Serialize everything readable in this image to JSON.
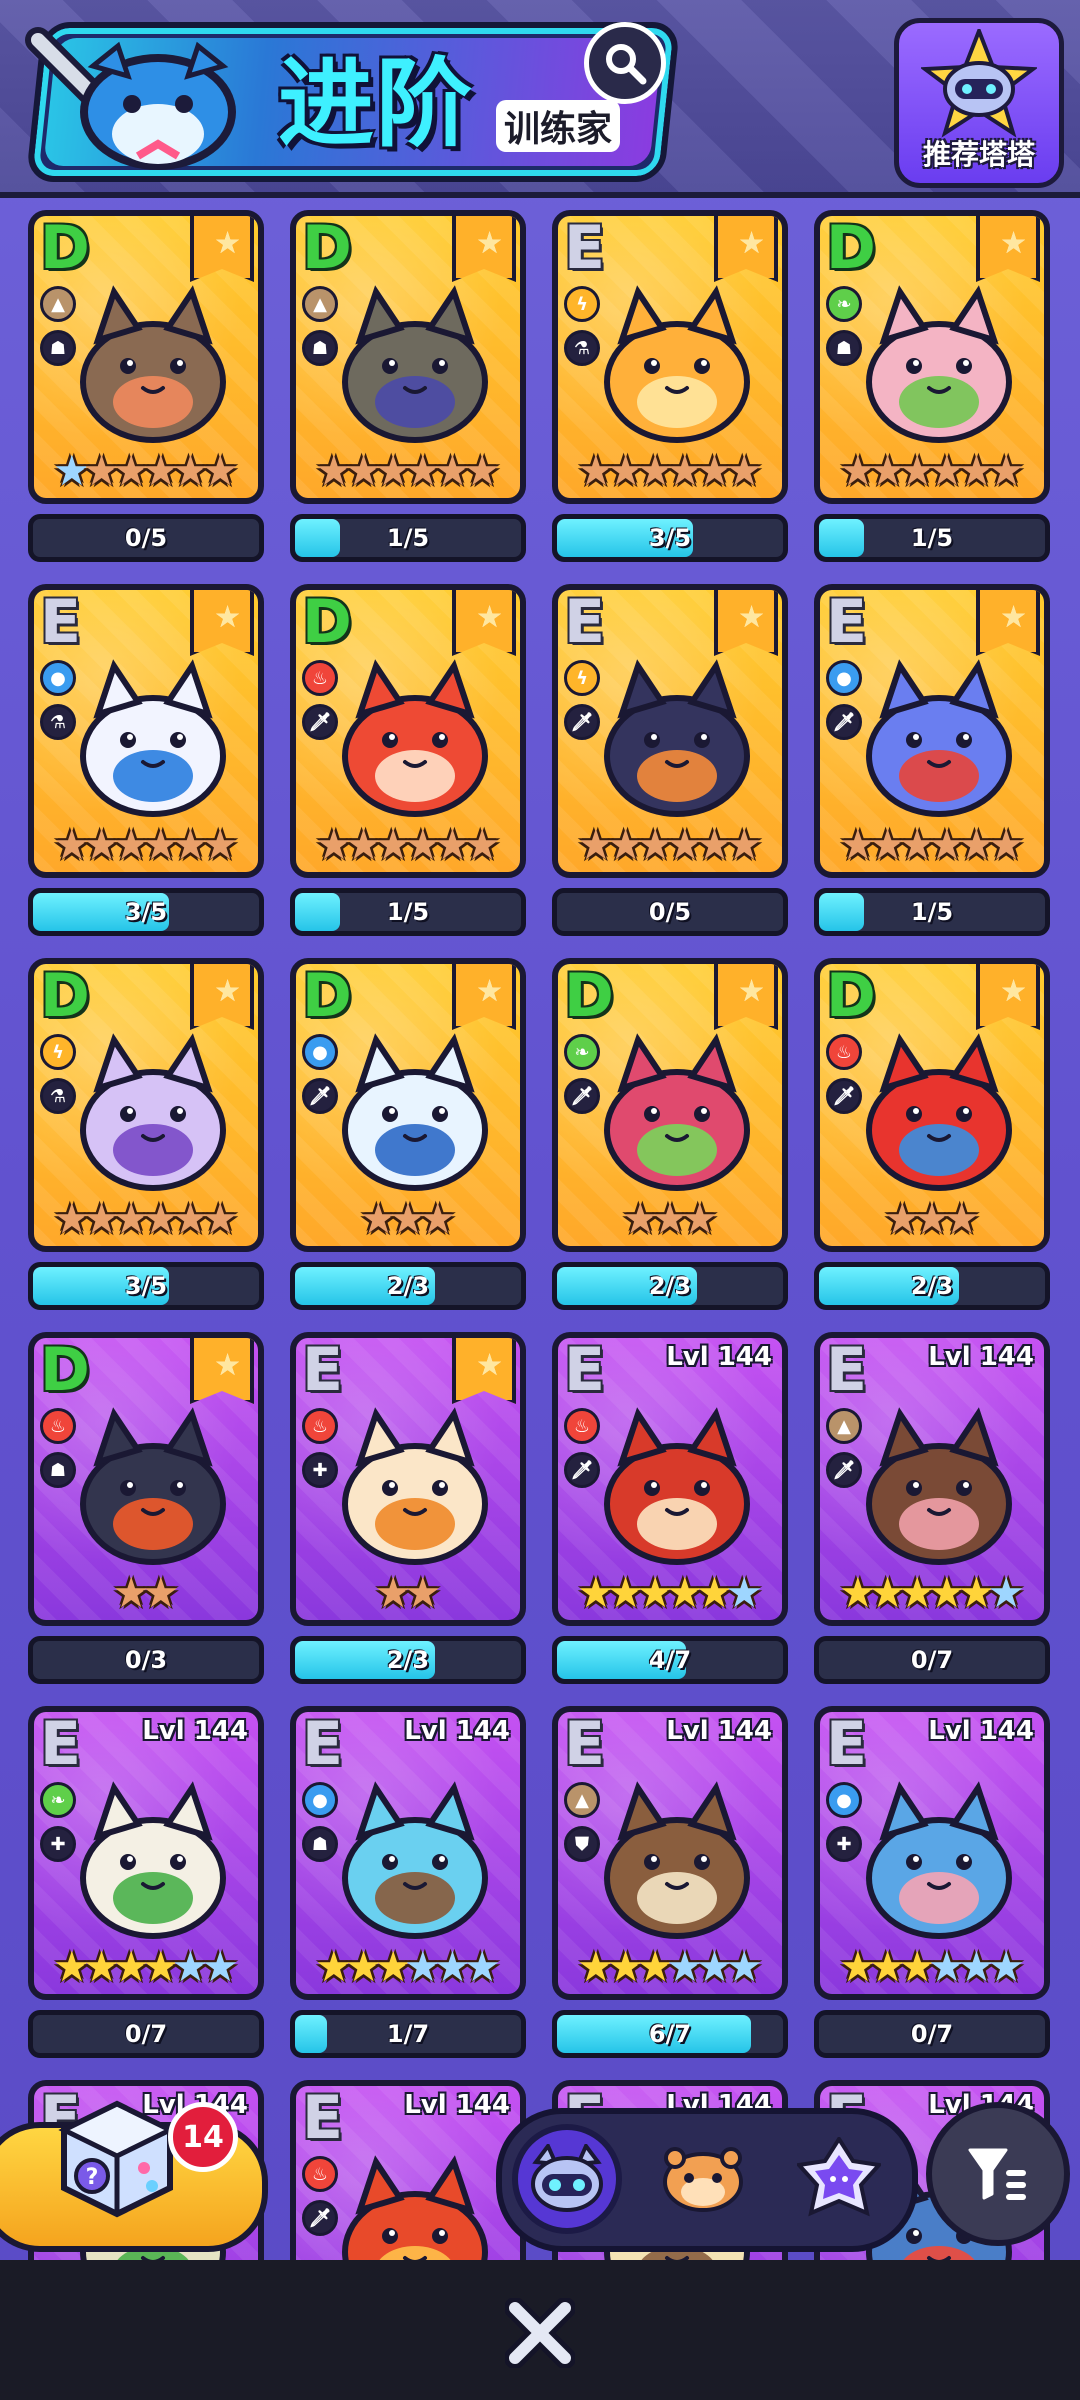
{
  "header": {
    "title": "进阶",
    "subtitle": "训练家",
    "recommend_label": "推荐塔塔"
  },
  "cards": [
    {
      "grade": "D",
      "bg": "yellow",
      "el": "earth",
      "el_color": "#b9936a",
      "role": "ghost",
      "stars": [
        "blue",
        "bronze",
        "bronze",
        "bronze",
        "bronze",
        "bronze"
      ],
      "ribbon": true,
      "lvl": "",
      "progress": "0/5",
      "fill": 0.0,
      "body": "#8a6a52",
      "accent": "#f08a5d"
    },
    {
      "grade": "D",
      "bg": "yellow",
      "el": "earth",
      "el_color": "#b9936a",
      "role": "ghost",
      "stars": [
        "bronze",
        "bronze",
        "bronze",
        "bronze",
        "bronze",
        "bronze"
      ],
      "ribbon": true,
      "lvl": "",
      "progress": "1/5",
      "fill": 0.2,
      "body": "#6e6a5e",
      "accent": "#4a4aa8"
    },
    {
      "grade": "E",
      "bg": "yellow",
      "el": "electric",
      "el_color": "#ffb52a",
      "role": "flask",
      "stars": [
        "bronze",
        "bronze",
        "bronze",
        "bronze",
        "bronze",
        "bronze"
      ],
      "ribbon": true,
      "lvl": "",
      "progress": "3/5",
      "fill": 0.6,
      "body": "#ffb03a",
      "accent": "#ffe7a0"
    },
    {
      "grade": "D",
      "bg": "yellow",
      "el": "grass",
      "el_color": "#5fcf4a",
      "role": "ghost",
      "stars": [
        "bronze",
        "bronze",
        "bronze",
        "bronze",
        "bronze",
        "bronze"
      ],
      "ribbon": true,
      "lvl": "",
      "progress": "1/5",
      "fill": 0.2,
      "body": "#f4b4c4",
      "accent": "#74c653"
    },
    {
      "grade": "E",
      "bg": "yellow",
      "el": "water",
      "el_color": "#3a9cf0",
      "role": "flask",
      "stars": [
        "bronze",
        "bronze",
        "bronze",
        "bronze",
        "bronze",
        "bronze"
      ],
      "ribbon": true,
      "lvl": "",
      "progress": "3/5",
      "fill": 0.6,
      "body": "#f2f4ff",
      "accent": "#2a7ee0"
    },
    {
      "grade": "D",
      "bg": "yellow",
      "el": "fire",
      "el_color": "#f0453a",
      "role": "dagger",
      "stars": [
        "bronze",
        "bronze",
        "bronze",
        "bronze",
        "bronze",
        "bronze"
      ],
      "ribbon": true,
      "lvl": "",
      "progress": "1/5",
      "fill": 0.2,
      "body": "#ee4a34",
      "accent": "#ffe0c8"
    },
    {
      "grade": "E",
      "bg": "yellow",
      "el": "electric",
      "el_color": "#ffb52a",
      "role": "dagger",
      "stars": [
        "bronze",
        "bronze",
        "bronze",
        "bronze",
        "bronze",
        "bronze"
      ],
      "ribbon": true,
      "lvl": "",
      "progress": "0/5",
      "fill": 0.0,
      "body": "#34345e",
      "accent": "#f58b3a"
    },
    {
      "grade": "E",
      "bg": "yellow",
      "el": "water",
      "el_color": "#3a9cf0",
      "role": "dagger",
      "stars": [
        "bronze",
        "bronze",
        "bronze",
        "bronze",
        "bronze",
        "bronze"
      ],
      "ribbon": true,
      "lvl": "",
      "progress": "1/5",
      "fill": 0.2,
      "body": "#6a7ef0",
      "accent": "#e8453a"
    },
    {
      "grade": "D",
      "bg": "yellow",
      "el": "electric",
      "el_color": "#ffb52a",
      "role": "flask",
      "stars": [
        "bronze",
        "bronze",
        "bronze",
        "bronze",
        "bronze",
        "bronze"
      ],
      "ribbon": true,
      "lvl": "",
      "progress": "3/5",
      "fill": 0.6,
      "body": "#d6c2f6",
      "accent": "#7a4ac8"
    },
    {
      "grade": "D",
      "bg": "yellow",
      "el": "water",
      "el_color": "#3a9cf0",
      "role": "dagger",
      "stars": [
        "bronze",
        "bronze",
        "bronze"
      ],
      "ribbon": true,
      "lvl": "",
      "progress": "2/3",
      "fill": 0.62,
      "body": "#e8f4ff",
      "accent": "#2e6ac8"
    },
    {
      "grade": "D",
      "bg": "yellow",
      "el": "grass",
      "el_color": "#5fcf4a",
      "role": "dagger",
      "stars": [
        "bronze",
        "bronze",
        "bronze"
      ],
      "ribbon": true,
      "lvl": "",
      "progress": "2/3",
      "fill": 0.62,
      "body": "#e04a6e",
      "accent": "#7ad45a"
    },
    {
      "grade": "D",
      "bg": "yellow",
      "el": "fire",
      "el_color": "#f0453a",
      "role": "dagger",
      "stars": [
        "bronze",
        "bronze",
        "bronze"
      ],
      "ribbon": true,
      "lvl": "",
      "progress": "2/3",
      "fill": 0.62,
      "body": "#e8342e",
      "accent": "#3a8ee0"
    },
    {
      "grade": "D",
      "bg": "purple",
      "el": "fire",
      "el_color": "#f0453a",
      "role": "ghost",
      "stars": [
        "bronze",
        "bronze"
      ],
      "ribbon": true,
      "lvl": "",
      "progress": "0/3",
      "fill": 0.0,
      "body": "#33354e",
      "accent": "#f05a2a"
    },
    {
      "grade": "E",
      "bg": "purple",
      "el": "fire",
      "el_color": "#f0453a",
      "role": "plus",
      "stars": [
        "bronze",
        "bronze"
      ],
      "ribbon": true,
      "lvl": "",
      "progress": "2/3",
      "fill": 0.62,
      "body": "#fbe6c8",
      "accent": "#f08a2a"
    },
    {
      "grade": "E",
      "bg": "purple",
      "el": "fire",
      "el_color": "#f0453a",
      "role": "dagger",
      "stars": [
        "gold",
        "gold",
        "gold",
        "gold",
        "gold",
        "blue"
      ],
      "ribbon": false,
      "lvl": "Lvl 144",
      "progress": "4/7",
      "fill": 0.57,
      "body": "#d83a2a",
      "accent": "#fde4c0"
    },
    {
      "grade": "E",
      "bg": "purple",
      "el": "earth",
      "el_color": "#b9936a",
      "role": "dagger",
      "stars": [
        "gold",
        "gold",
        "gold",
        "gold",
        "gold",
        "blue"
      ],
      "ribbon": false,
      "lvl": "Lvl 144",
      "progress": "0/7",
      "fill": 0.0,
      "body": "#7a4a36",
      "accent": "#f0a0a8"
    },
    {
      "grade": "E",
      "bg": "purple",
      "el": "grass",
      "el_color": "#5fcf4a",
      "role": "plus",
      "stars": [
        "gold",
        "gold",
        "gold",
        "gold",
        "blue",
        "blue"
      ],
      "ribbon": false,
      "lvl": "Lvl 144",
      "progress": "0/7",
      "fill": 0.0,
      "body": "#f4f0e4",
      "accent": "#4ab04a"
    },
    {
      "grade": "E",
      "bg": "purple",
      "el": "water",
      "el_color": "#3a9cf0",
      "role": "ghost",
      "stars": [
        "gold",
        "gold",
        "gold",
        "blue",
        "blue",
        "blue"
      ],
      "ribbon": false,
      "lvl": "Lvl 144",
      "progress": "1/7",
      "fill": 0.14,
      "body": "#6ad0f0",
      "accent": "#8a5a3a"
    },
    {
      "grade": "E",
      "bg": "purple",
      "el": "earth",
      "el_color": "#b9936a",
      "role": "shield",
      "stars": [
        "gold",
        "gold",
        "gold",
        "blue",
        "blue",
        "blue"
      ],
      "ribbon": false,
      "lvl": "Lvl 144",
      "progress": "6/7",
      "fill": 0.86,
      "body": "#8a5e3e",
      "accent": "#f4e4c4"
    },
    {
      "grade": "E",
      "bg": "purple",
      "el": "water",
      "el_color": "#3a9cf0",
      "role": "plus",
      "stars": [
        "gold",
        "gold",
        "gold",
        "blue",
        "blue",
        "blue"
      ],
      "ribbon": false,
      "lvl": "Lvl 144",
      "progress": "0/7",
      "fill": 0.0,
      "body": "#5aa6e6",
      "accent": "#f4a4b4"
    },
    {
      "grade": "E",
      "bg": "purple",
      "el": "grass",
      "el_color": "#5fcf4a",
      "role": "plus",
      "stars": [],
      "ribbon": false,
      "lvl": "Lvl 144",
      "progress": "",
      "fill": 0.0,
      "body": "#e6e4c4",
      "accent": "#4ab04a"
    },
    {
      "grade": "E",
      "bg": "purple",
      "el": "fire",
      "el_color": "#f0453a",
      "role": "dagger",
      "stars": [],
      "ribbon": false,
      "lvl": "Lvl 144",
      "progress": "",
      "fill": 0.0,
      "body": "#e84a2a",
      "accent": "#ffc04a"
    },
    {
      "grade": "E",
      "bg": "purple",
      "el": "earth",
      "el_color": "#b9936a",
      "role": "ghost",
      "stars": [],
      "ribbon": false,
      "lvl": "Lvl 144",
      "progress": "",
      "fill": 0.0,
      "body": "#f4e2b4",
      "accent": "#8a5e3e"
    },
    {
      "grade": "E",
      "bg": "purple",
      "el": "water",
      "el_color": "#3a9cf0",
      "role": "ghost",
      "stars": [],
      "ribbon": false,
      "lvl": "Lvl 144",
      "progress": "",
      "fill": 0.0,
      "body": "#4a7ec8",
      "accent": "#f04a3a"
    }
  ],
  "gift": {
    "count": "14"
  },
  "tabs": [
    {
      "name": "tab-towers",
      "active": true
    },
    {
      "name": "tab-monsters",
      "active": false
    },
    {
      "name": "tab-crystals",
      "active": false
    }
  ],
  "colors": {
    "accent_cyan": "#3ef0ff",
    "progress_fill": "#25c4e8",
    "gift_badge": "#e21e3c"
  }
}
